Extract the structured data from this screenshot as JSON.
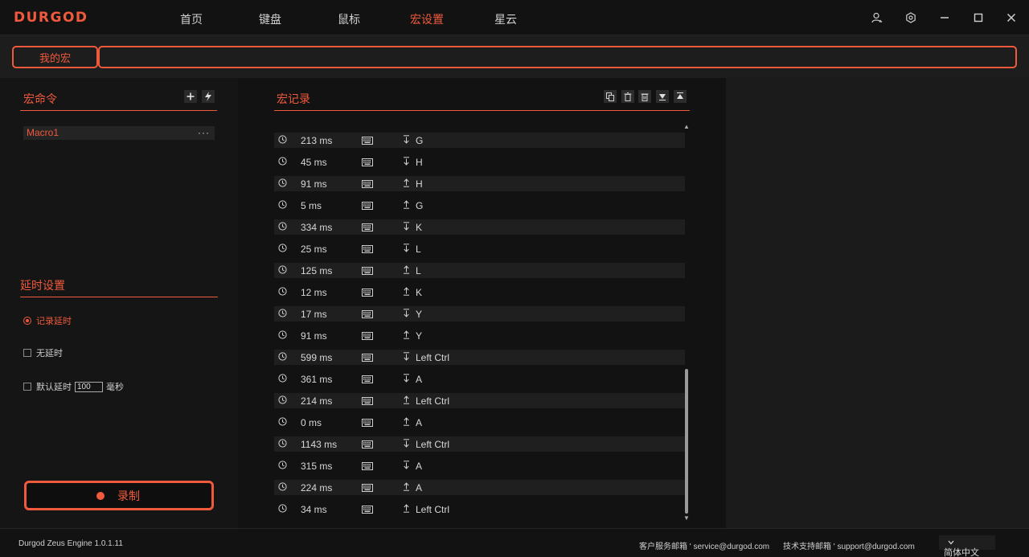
{
  "app": {
    "logo": "DURGOD"
  },
  "nav": [
    {
      "label": "首页",
      "active": false
    },
    {
      "label": "键盘",
      "active": false
    },
    {
      "label": "鼠标",
      "active": false
    },
    {
      "label": "宏设置",
      "active": true
    },
    {
      "label": "星云",
      "active": false
    }
  ],
  "window_controls": [
    "user-icon",
    "settings-icon",
    "minimize-icon",
    "maximize-icon",
    "close-icon"
  ],
  "tabbar": {
    "my_macro": "我的宏",
    "macro_name_value": ""
  },
  "macro_panel": {
    "title": "宏命令",
    "add_icon": "plus-icon",
    "import_icon": "bolt-icon",
    "items": [
      {
        "name": "Macro1",
        "more": "···"
      }
    ]
  },
  "delay_settings": {
    "title": "延时设置",
    "options": {
      "record": "记录延时",
      "none": "无延时",
      "default": "默认延时",
      "default_value": "100",
      "unit": "毫秒"
    },
    "selected": "record"
  },
  "record_button": {
    "label": "录制"
  },
  "record_panel": {
    "title": "宏记录",
    "tools": [
      "copy-icon",
      "delete-icon",
      "clear-icon",
      "move-down-icon",
      "move-up-icon"
    ],
    "rows": [
      {
        "delay": "213 ms",
        "dir": "down",
        "key": "G"
      },
      {
        "delay": "45 ms",
        "dir": "down",
        "key": "H"
      },
      {
        "delay": "91 ms",
        "dir": "up",
        "key": "H"
      },
      {
        "delay": "5 ms",
        "dir": "up",
        "key": "G"
      },
      {
        "delay": "334 ms",
        "dir": "down",
        "key": "K"
      },
      {
        "delay": "25 ms",
        "dir": "down",
        "key": "L"
      },
      {
        "delay": "125 ms",
        "dir": "up",
        "key": "L"
      },
      {
        "delay": "12 ms",
        "dir": "up",
        "key": "K"
      },
      {
        "delay": "17 ms",
        "dir": "down",
        "key": "Y"
      },
      {
        "delay": "91 ms",
        "dir": "up",
        "key": "Y"
      },
      {
        "delay": "599 ms",
        "dir": "down",
        "key": "Left Ctrl"
      },
      {
        "delay": "361 ms",
        "dir": "down",
        "key": "A"
      },
      {
        "delay": "214 ms",
        "dir": "up",
        "key": "Left Ctrl"
      },
      {
        "delay": "0 ms",
        "dir": "up",
        "key": "A"
      },
      {
        "delay": "1143 ms",
        "dir": "down",
        "key": "Left Ctrl"
      },
      {
        "delay": "315 ms",
        "dir": "down",
        "key": "A"
      },
      {
        "delay": "224 ms",
        "dir": "up",
        "key": "A"
      },
      {
        "delay": "34 ms",
        "dir": "up",
        "key": "Left Ctrl"
      }
    ]
  },
  "footer": {
    "version": "Durgod Zeus Engine 1.0.1.11",
    "service_label": "客户服务邮箱",
    "service_email": "service@durgod.com",
    "support_label": "技术支持邮箱",
    "support_email": "support@durgod.com",
    "language": "简体中文"
  },
  "colors": {
    "accent": "#f05a3c",
    "background": "#1a1a1a"
  }
}
